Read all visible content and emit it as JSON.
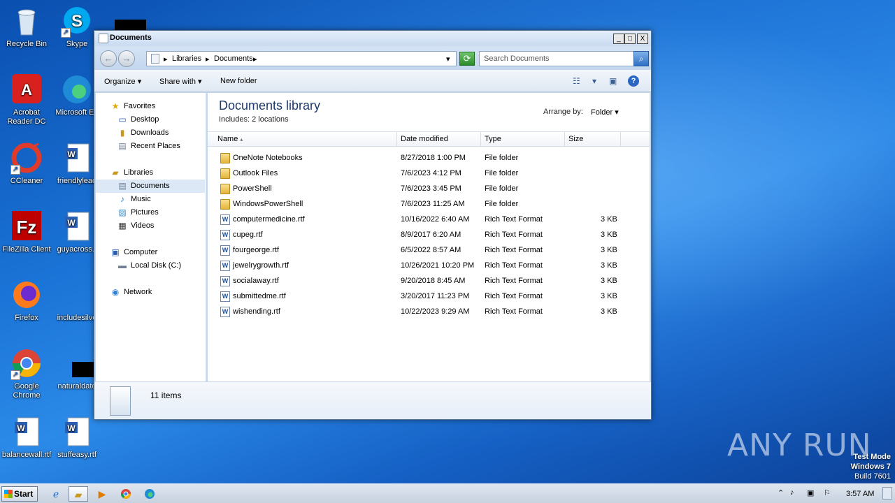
{
  "desktop": {
    "icons": [
      {
        "label": "Recycle Bin",
        "icon": "recycle-bin-icon"
      },
      {
        "label": "Skype",
        "icon": "skype-icon"
      },
      {
        "label": "Acrobat Reader DC",
        "icon": "acrobat-icon"
      },
      {
        "label": "Microsoft Ed",
        "icon": "edge-icon"
      },
      {
        "label": "CCleaner",
        "icon": "ccleaner-icon"
      },
      {
        "label": "friendlylead",
        "icon": "word-doc-icon"
      },
      {
        "label": "FileZilla Client",
        "icon": "filezilla-icon"
      },
      {
        "label": "guyacross.r",
        "icon": "word-doc-icon"
      },
      {
        "label": "Firefox",
        "icon": "firefox-icon"
      },
      {
        "label": "includesilve",
        "icon": "blank-file-icon"
      },
      {
        "label": "Google Chrome",
        "icon": "chrome-icon"
      },
      {
        "label": "naturaldate",
        "icon": "blank-file-icon"
      },
      {
        "label": "balancewall.rtf",
        "icon": "word-doc-icon"
      },
      {
        "label": "stuffeasy.rtf",
        "icon": "word-doc-icon"
      }
    ],
    "watermark": {
      "line1": "Test Mode",
      "line2": "Windows 7",
      "line3": "Build 7601"
    },
    "brand": "ANY RUN"
  },
  "window": {
    "title": "Documents",
    "controls": {
      "minimize": "_",
      "maximize": "□",
      "close": "X"
    },
    "address": {
      "segments": [
        "Libraries",
        "Documents"
      ]
    },
    "search": {
      "placeholder": "Search Documents"
    },
    "toolbar": {
      "organize": "Organize",
      "share_with": "Share with",
      "new_folder": "New folder"
    },
    "nav": {
      "favorites": {
        "label": "Favorites",
        "items": [
          "Desktop",
          "Downloads",
          "Recent Places"
        ]
      },
      "libraries": {
        "label": "Libraries",
        "items": [
          "Documents",
          "Music",
          "Pictures",
          "Videos"
        ]
      },
      "computer": {
        "label": "Computer",
        "items": [
          "Local Disk (C:)"
        ]
      },
      "network": {
        "label": "Network"
      }
    },
    "content": {
      "title": "Documents library",
      "includes": "Includes:  2 locations",
      "arrange_label": "Arrange by:",
      "arrange_value": "Folder",
      "columns": [
        "Name",
        "Date modified",
        "Type",
        "Size"
      ],
      "rows": [
        {
          "name": "OneNote Notebooks",
          "date": "8/27/2018 1:00 PM",
          "type": "File folder",
          "size": "",
          "kind": "folder"
        },
        {
          "name": "Outlook Files",
          "date": "7/6/2023 4:12 PM",
          "type": "File folder",
          "size": "",
          "kind": "folder"
        },
        {
          "name": "PowerShell",
          "date": "7/6/2023 3:45 PM",
          "type": "File folder",
          "size": "",
          "kind": "folder"
        },
        {
          "name": "WindowsPowerShell",
          "date": "7/6/2023 11:25 AM",
          "type": "File folder",
          "size": "",
          "kind": "folder"
        },
        {
          "name": "computermedicine.rtf",
          "date": "10/16/2022 6:40 AM",
          "type": "Rich Text Format",
          "size": "3 KB",
          "kind": "doc"
        },
        {
          "name": "cupeg.rtf",
          "date": "8/9/2017 6:20 AM",
          "type": "Rich Text Format",
          "size": "3 KB",
          "kind": "doc"
        },
        {
          "name": "fourgeorge.rtf",
          "date": "6/5/2022 8:57 AM",
          "type": "Rich Text Format",
          "size": "3 KB",
          "kind": "doc"
        },
        {
          "name": "jewelrygrowth.rtf",
          "date": "10/26/2021 10:20 PM",
          "type": "Rich Text Format",
          "size": "3 KB",
          "kind": "doc"
        },
        {
          "name": "socialaway.rtf",
          "date": "9/20/2018 8:45 AM",
          "type": "Rich Text Format",
          "size": "3 KB",
          "kind": "doc"
        },
        {
          "name": "submittedme.rtf",
          "date": "3/20/2017 11:23 PM",
          "type": "Rich Text Format",
          "size": "3 KB",
          "kind": "doc"
        },
        {
          "name": "wishending.rtf",
          "date": "10/22/2023 9:29 AM",
          "type": "Rich Text Format",
          "size": "3 KB",
          "kind": "doc"
        }
      ]
    },
    "status": {
      "count": "11 items"
    }
  },
  "taskbar": {
    "start": "Start",
    "apps": [
      "ie-icon",
      "explorer-icon",
      "media-player-icon",
      "chrome-icon",
      "edge-icon"
    ],
    "clock": "3:57 AM"
  }
}
